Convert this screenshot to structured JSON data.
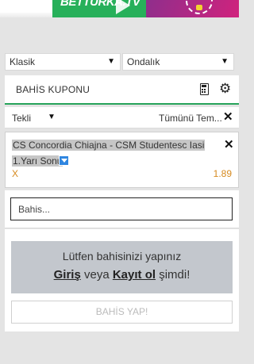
{
  "banner": {
    "brand_text": "BETTURKA.TV"
  },
  "settings": {
    "display_type": "Klasik",
    "odds_format": "Ondalık"
  },
  "coupon": {
    "title": "BAHİS KUPONU",
    "bet_type": "Tekli",
    "clear_all_label": "Tümünü Tem..."
  },
  "bet": {
    "match": "CS Concordia Chiajna - CSM Studentesc Iasi",
    "market": "1.Yarı Sonu",
    "selection": "X",
    "odds": "1.89"
  },
  "stake": {
    "placeholder": "Bahis..."
  },
  "login_prompt": {
    "line1": "Lütfen bahisinizi yapınız",
    "login_link": "Giriş",
    "or_text": "veya",
    "register_link": "Kayıt ol",
    "now_text": "şimdi!"
  },
  "place_bet_label": "BAHİS YAP!",
  "colors": {
    "accent_green": "#27a35a",
    "odds_orange": "#d68a1f",
    "login_box": "#c3c7cd"
  }
}
